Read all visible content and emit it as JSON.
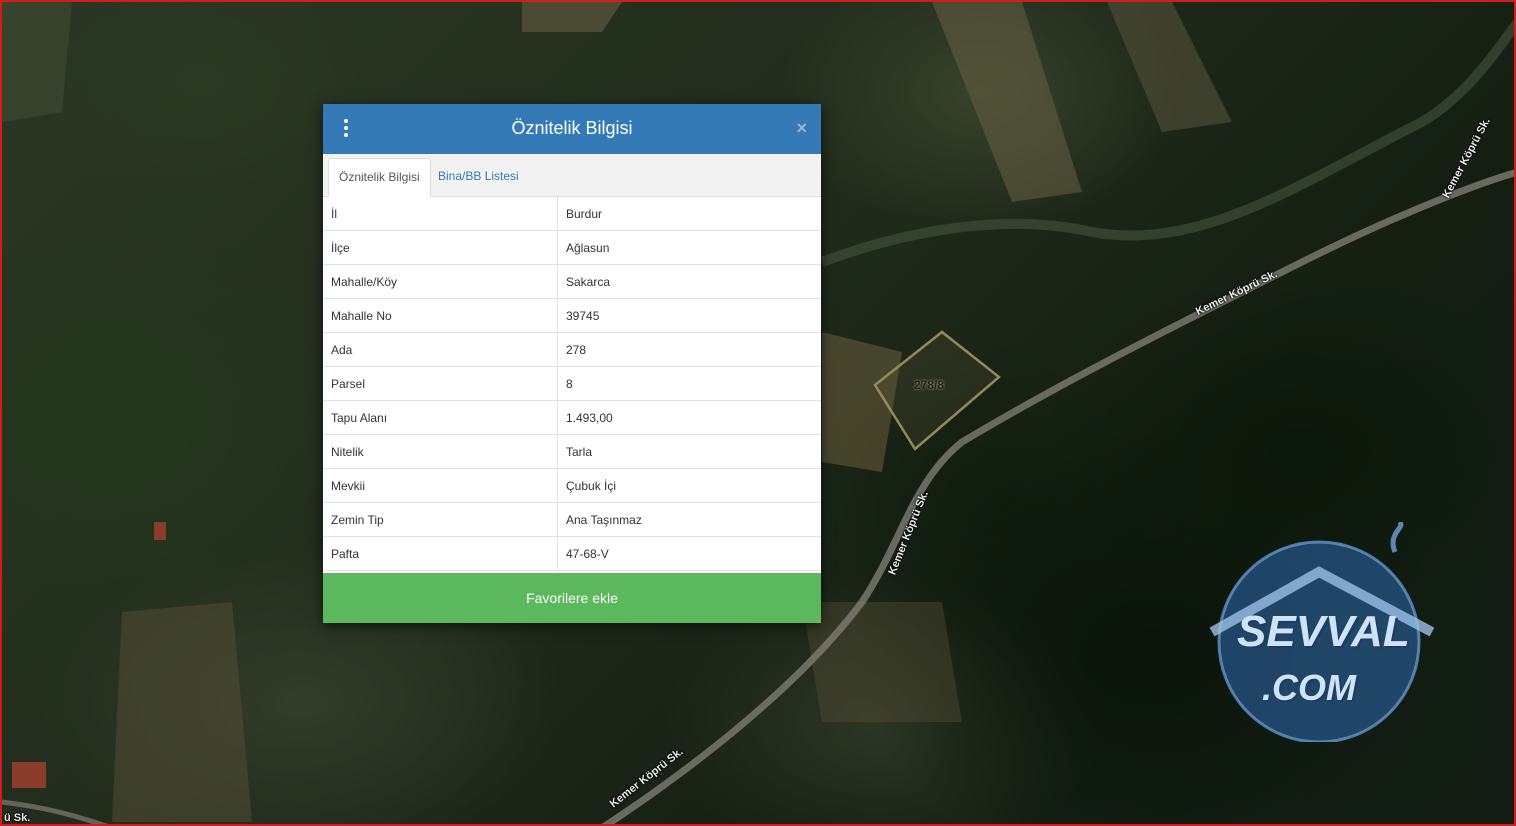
{
  "modal": {
    "title": "Öznitelik Bilgisi",
    "close_symbol": "×",
    "menu_icon": "kebab-menu-icon",
    "tabs": [
      {
        "label": "Öznitelik Bilgisi",
        "active": true
      },
      {
        "label": "Bina/BB Listesi",
        "active": false
      }
    ],
    "rows": [
      {
        "key": "İl",
        "value": "Burdur"
      },
      {
        "key": "İlçe",
        "value": "Ağlasun"
      },
      {
        "key": "Mahalle/Köy",
        "value": "Sakarca"
      },
      {
        "key": "Mahalle No",
        "value": "39745"
      },
      {
        "key": "Ada",
        "value": "278"
      },
      {
        "key": "Parsel",
        "value": "8"
      },
      {
        "key": "Tapu Alanı",
        "value": "1.493,00"
      },
      {
        "key": "Nitelik",
        "value": "Tarla"
      },
      {
        "key": "Mevkii",
        "value": "Çubuk İçi"
      },
      {
        "key": "Zemin Tip",
        "value": "Ana Taşınmaz"
      },
      {
        "key": "Pafta",
        "value": "47-68-V"
      }
    ],
    "favorite_button": "Favorilere ekle"
  },
  "map": {
    "parcel_label": "278/8",
    "road_labels": [
      "Kemer Köprü Sk.",
      "Kemer Köprü Sk.",
      "Kemer Köprü Sk.",
      "Kemer Köprü Sk.",
      "ü Sk."
    ]
  },
  "watermark": {
    "line1": "SEVVAL",
    "line2": ".COM"
  },
  "colors": {
    "header": "#337ab7",
    "button": "#5cb85c",
    "frame_border": "#d11d1d",
    "parcel_outline": "#c9b97a"
  }
}
